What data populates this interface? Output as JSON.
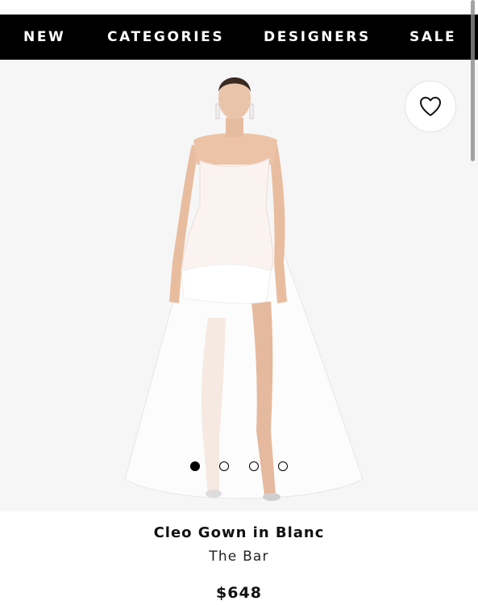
{
  "nav": {
    "items": [
      {
        "label": "NEW"
      },
      {
        "label": "CATEGORIES"
      },
      {
        "label": "DESIGNERS"
      },
      {
        "label": "SALE"
      }
    ]
  },
  "product": {
    "name": "Cleo Gown in Blanc",
    "designer": "The Bar",
    "price": "$648",
    "image_icon": "dress-photo",
    "favorite_icon": "heart-icon",
    "gallery": {
      "total_images": 4,
      "active_index": 1
    }
  },
  "colors": {
    "nav_bg": "#000000",
    "nav_text": "#ffffff",
    "image_bg": "#f6f6f6"
  }
}
